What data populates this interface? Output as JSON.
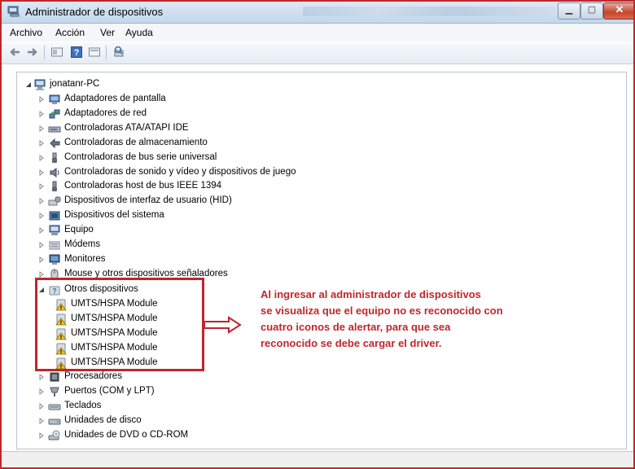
{
  "window": {
    "title": "Administrador de dispositivos"
  },
  "menu": {
    "items": [
      "Archivo",
      "Acción",
      "Ver",
      "Ayuda"
    ]
  },
  "toolbar": {
    "icons": [
      "back-arrow-icon",
      "forward-arrow-icon",
      "properties-icon",
      "help-icon",
      "view-icon",
      "scan-hardware-icon"
    ]
  },
  "tree": {
    "root": "jonatanr-PC",
    "items": [
      {
        "label": "Adaptadores de pantalla",
        "icon": "display-adapter-icon"
      },
      {
        "label": "Adaptadores de red",
        "icon": "network-adapter-icon"
      },
      {
        "label": "Controladoras ATA/ATAPI IDE",
        "icon": "ide-controller-icon"
      },
      {
        "label": "Controladoras de almacenamiento",
        "icon": "storage-controller-icon"
      },
      {
        "label": "Controladoras de bus serie universal",
        "icon": "usb-icon"
      },
      {
        "label": "Controladoras de sonido y vídeo y dispositivos de juego",
        "icon": "sound-icon"
      },
      {
        "label": "Controladoras host de bus IEEE 1394",
        "icon": "firewire-icon"
      },
      {
        "label": "Dispositivos de interfaz de usuario (HID)",
        "icon": "hid-icon"
      },
      {
        "label": "Dispositivos del sistema",
        "icon": "system-devices-icon"
      },
      {
        "label": "Equipo",
        "icon": "computer-icon"
      },
      {
        "label": "Módems",
        "icon": "modem-icon"
      },
      {
        "label": "Monitores",
        "icon": "monitor-icon"
      },
      {
        "label": "Mouse y otros dispositivos señaladores",
        "icon": "mouse-icon"
      }
    ],
    "other": {
      "label": "Otros dispositivos",
      "children": [
        "UMTS/HSPA Module",
        "UMTS/HSPA Module",
        "UMTS/HSPA Module",
        "UMTS/HSPA Module",
        "UMTS/HSPA Module"
      ]
    },
    "after": [
      {
        "label": "Procesadores",
        "icon": "processor-icon"
      },
      {
        "label": "Puertos (COM y LPT)",
        "icon": "port-icon"
      },
      {
        "label": "Teclados",
        "icon": "keyboard-icon"
      },
      {
        "label": "Unidades de disco",
        "icon": "disk-drive-icon"
      },
      {
        "label": "Unidades de DVD o CD-ROM",
        "icon": "dvd-drive-icon"
      }
    ]
  },
  "annotation": {
    "lines": [
      "Al  ingresar al  administrador  de  dispositivos",
      "se visualiza  que el equipo no es reconocido  con",
      "cuatro iconos  de alertar, para que sea",
      "reconocido se debe  cargar el driver."
    ]
  },
  "colors": {
    "annotation": "#c0262c",
    "highlight_border": "#c0262c",
    "titlebar": "#dce8f5"
  }
}
